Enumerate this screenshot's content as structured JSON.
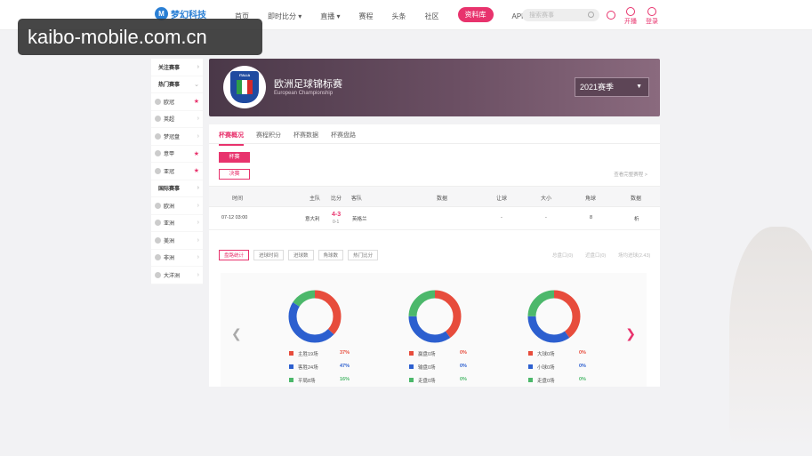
{
  "watermark": {
    "text": "kaibo-mobile.com.cn"
  },
  "header": {
    "logo_badge": "M",
    "logo_text": "梦幻科技",
    "nav": [
      {
        "label": "首页"
      },
      {
        "label": "即时比分 ▾"
      },
      {
        "label": "直播 ▾"
      },
      {
        "label": "赛程"
      },
      {
        "label": "头条"
      },
      {
        "label": "社区"
      },
      {
        "label": "资料库"
      },
      {
        "label": "APP下载"
      }
    ],
    "active_nav": 6,
    "search_placeholder": "搜索赛事",
    "live_label": "开播",
    "login_label": "登录"
  },
  "sidebar": {
    "items": [
      {
        "label": "关注赛事",
        "type": "head"
      },
      {
        "label": "热门赛事",
        "type": "head"
      },
      {
        "label": "欧冠",
        "star": true
      },
      {
        "label": "英超"
      },
      {
        "label": "梦冠盘"
      },
      {
        "label": "意甲",
        "star": true
      },
      {
        "label": "亚冠",
        "star": true
      },
      {
        "label": "国际赛事",
        "type": "head"
      },
      {
        "label": "欧洲"
      },
      {
        "label": "亚洲"
      },
      {
        "label": "美洲"
      },
      {
        "label": "非洲"
      },
      {
        "label": "大洋洲"
      }
    ]
  },
  "banner": {
    "emblem_text": "ITALIA",
    "title": "欧洲足球锦标赛",
    "subtitle": "European Championship",
    "season": "2021赛季"
  },
  "tabs": [
    {
      "label": "杯赛概况"
    },
    {
      "label": "赛程积分"
    },
    {
      "label": "杯赛数据"
    },
    {
      "label": "杯赛盘路"
    }
  ],
  "stages": {
    "a": "杯赛",
    "b": "决赛"
  },
  "all_link": "查看完整赛程 >",
  "table": {
    "headers": [
      "时间",
      "主队",
      "比分",
      "客队",
      "数据",
      "让球",
      "大小",
      "角球",
      "数据"
    ],
    "row": {
      "time": "07-12 03:00",
      "home": "意大利",
      "score": "4-3",
      "half": "0-1",
      "away": "英格兰",
      "handicap": "-",
      "total": "-",
      "corners": "8",
      "data": "析"
    }
  },
  "stat_tabs": [
    {
      "label": "盘路统计"
    },
    {
      "label": "进球时间"
    },
    {
      "label": "进球数"
    },
    {
      "label": "角球数"
    },
    {
      "label": "热门比分"
    }
  ],
  "stat_links": [
    "总盘口(0)",
    "近盘口(0)",
    "场均进球(2.43)"
  ],
  "colors": {
    "accent": "#e8336d",
    "red": "#e74c3c",
    "blue": "#2c5fcf",
    "green": "#4cb86b"
  },
  "chart_data": [
    {
      "type": "pie",
      "labels": [
        "主胜19场",
        "客胜24场",
        "平局8场"
      ],
      "values": [
        37,
        47,
        16
      ],
      "percents": [
        "37%",
        "47%",
        "16%"
      ]
    },
    {
      "type": "pie",
      "labels": [
        "赢盘0场",
        "输盘0场",
        "走盘0场"
      ],
      "values": [
        40,
        35,
        25
      ],
      "percents": [
        "0%",
        "0%",
        "0%"
      ]
    },
    {
      "type": "pie",
      "labels": [
        "大球0场",
        "小球0场",
        "走盘0场"
      ],
      "values": [
        40,
        35,
        25
      ],
      "percents": [
        "0%",
        "0%",
        "0%"
      ]
    }
  ]
}
